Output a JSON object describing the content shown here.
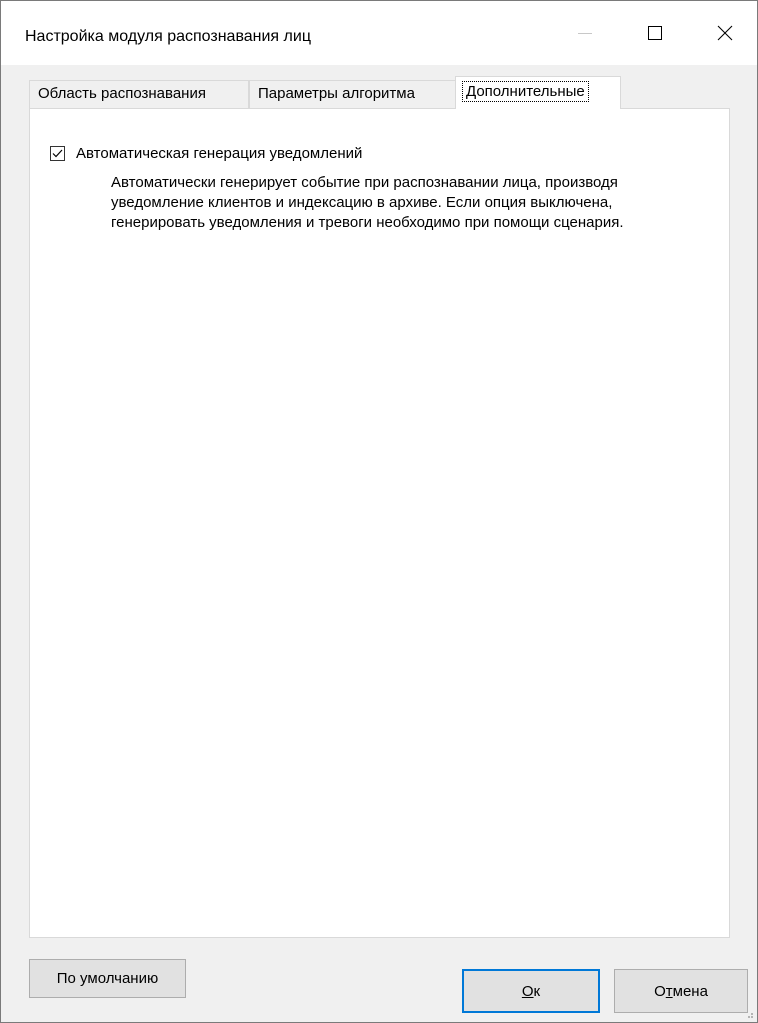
{
  "window": {
    "title": "Настройка модуля распознавания лиц"
  },
  "tabs": [
    {
      "label": "Область распознавания",
      "selected": false
    },
    {
      "label": "Параметры алгоритма",
      "selected": false
    },
    {
      "label": "Дополнительные",
      "selected": true
    }
  ],
  "options": {
    "auto_notify_label": "Автоматическая генерация уведомлений",
    "auto_notify_checked": true,
    "description": "Автоматически генерирует событие при распознавании лица, производя уведомление клиентов и индексацию в архиве. Если опция выключена, генерировать уведомления и тревоги необходимо при помощи сценария."
  },
  "buttons": {
    "defaults": "По умолчанию",
    "ok_mnemonic": "О",
    "ok_rest": "к",
    "cancel_pre": "О",
    "cancel_mnemonic": "т",
    "cancel_rest": "мена"
  },
  "colors": {
    "accent": "#0078d7",
    "background": "#f0f0f0",
    "panel": "#ffffff"
  }
}
